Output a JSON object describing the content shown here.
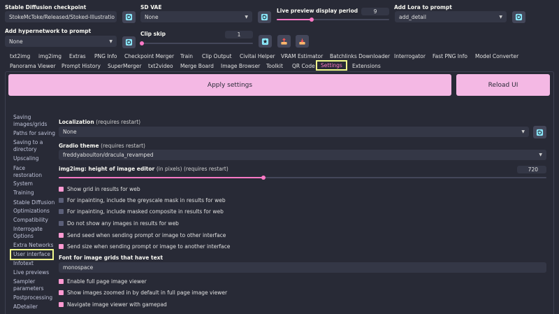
{
  "top": {
    "checkpoint": {
      "label": "Stable Diffusion checkpoint",
      "value": "StokeMcToke/Released/Stoked-Illustratio"
    },
    "vae": {
      "label": "SD VAE",
      "value": "None"
    },
    "preview_period": {
      "label": "Live preview display period",
      "value": "9",
      "fraction": 0.31
    },
    "lora": {
      "label": "Add Lora to prompt",
      "value": "add_detail"
    },
    "hypernetwork": {
      "label": "Add hypernetwork to prompt",
      "value": "None"
    },
    "clip_skip": {
      "label": "Clip skip",
      "value": "1",
      "fraction": 0.0
    }
  },
  "tabs_row1": [
    "txt2img",
    "img2img",
    "Extras",
    "PNG Info",
    "Checkpoint Merger",
    "Train",
    "Clip Output",
    "Civitai Helper",
    "VRAM Estimator",
    "Batchlinks Downloader",
    "Interrogator",
    "Fast PNG Info",
    "Model Converter"
  ],
  "tabs_row2": [
    "Panorama Viewer",
    "Prompt History",
    "SuperMerger",
    "txt2video",
    "Merge Board",
    "Image Browser",
    "Toolkit",
    "QR Code",
    "Settings",
    "Extensions"
  ],
  "buttons": {
    "apply": "Apply settings",
    "reload": "Reload UI"
  },
  "sidebar": [
    "Saving images/grids",
    "Paths for saving",
    "Saving to a directory",
    "Upscaling",
    "Face restoration",
    "System",
    "Training",
    "Stable Diffusion",
    "Optimizations",
    "Compatibility",
    "Interrogate Options",
    "Extra Networks",
    "User interface",
    "Infotext",
    "Live previews",
    "Sampler parameters",
    "Postprocessing",
    "ADetailer"
  ],
  "settings": {
    "localization": {
      "label": "Localization",
      "note": "(requires restart)",
      "value": "None"
    },
    "gradio_theme": {
      "label": "Gradio theme",
      "note": "(requires restart)",
      "value": "freddyaboulton/dracula_revamped"
    },
    "editor_height": {
      "label": "img2img: height of image editor",
      "note": "(in pixels) (requires restart)",
      "value": "720",
      "fraction": 0.42
    },
    "checkboxes_a": [
      {
        "label": "Show grid in results for web",
        "checked": true
      },
      {
        "label": "For inpainting, include the greyscale mask in results for web",
        "checked": false
      },
      {
        "label": "For inpainting, include masked composite in results for web",
        "checked": false
      },
      {
        "label": "Do not show any images in results for web",
        "checked": false
      },
      {
        "label": "Send seed when sending prompt or image to other interface",
        "checked": true
      },
      {
        "label": "Send size when sending prompt or image to another interface",
        "checked": true
      }
    ],
    "font": {
      "label": "Font for image grids that have text",
      "value": "monospace"
    },
    "checkboxes_b": [
      {
        "label": "Enable full page image viewer",
        "checked": true
      },
      {
        "label": "Show images zoomed in by default in full page image viewer",
        "checked": true
      },
      {
        "label": "Navigate image viewer with gamepad",
        "checked": true
      }
    ]
  },
  "colors": {
    "accent": "#ff79c6",
    "button_bg": "#f4b8e4",
    "highlight": "#f1fa8c",
    "background": "#282a36"
  }
}
